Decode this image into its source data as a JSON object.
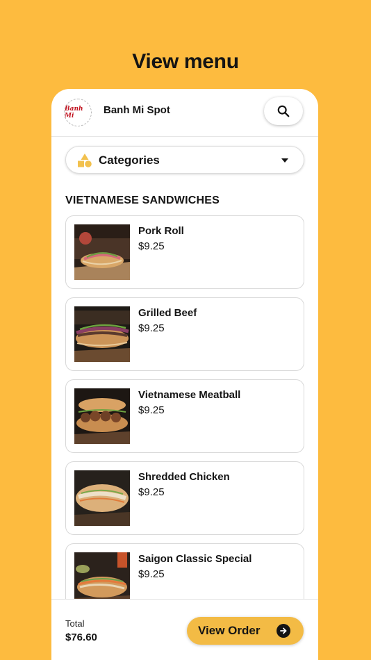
{
  "page": {
    "title": "View menu"
  },
  "header": {
    "restaurant_name": "Banh Mi Spot",
    "logo_text": "Banh Mi",
    "search_icon": "search-icon"
  },
  "categories": {
    "label": "Categories",
    "icon": "shapes-icon",
    "caret_icon": "caret-down-icon"
  },
  "section": {
    "title": "VIETNAMESE SANDWICHES"
  },
  "items": [
    {
      "name": "Pork Roll",
      "price": "$9.25"
    },
    {
      "name": "Grilled Beef",
      "price": "$9.25"
    },
    {
      "name": "Vietnamese Meatball",
      "price": "$9.25"
    },
    {
      "name": "Shredded Chicken",
      "price": "$9.25"
    },
    {
      "name": "Saigon Classic Special",
      "price": "$9.25"
    }
  ],
  "footer": {
    "total_label": "Total",
    "total_value": "$76.60",
    "view_order_label": "View Order",
    "arrow_icon": "arrow-right-icon"
  },
  "colors": {
    "background": "#FDBB3F",
    "button": "#F3BB45",
    "icon_accent": "#F2C14E"
  }
}
